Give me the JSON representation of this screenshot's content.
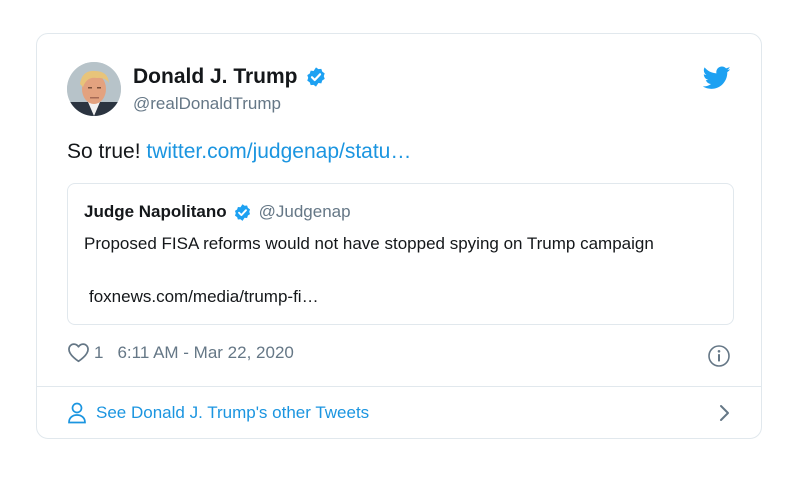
{
  "tweet": {
    "author": {
      "display_name": "Donald J. Trump",
      "handle": "@realDonaldTrump",
      "verified": true
    },
    "text_prefix": "So true! ",
    "text_link": "twitter.com/judgenap/statu…",
    "quoted": {
      "display_name": "Judge Napolitano",
      "handle": "@Judgenap",
      "verified": true,
      "text": "Proposed FISA reforms would not have stopped spying on Trump campaign",
      "link": "foxnews.com/media/trump-fi…"
    },
    "like_count": "1",
    "timestamp": "6:11 AM - Mar 22, 2020"
  },
  "footer": {
    "label": "See Donald J. Trump's other Tweets"
  },
  "icons": {
    "brand": "twitter-bird",
    "verified": "verified-badge",
    "like": "heart-outline",
    "info": "info-circle",
    "profile": "person-outline",
    "next": "chevron-right"
  },
  "colors": {
    "link": "#1b95e0",
    "verified": "#1da1f2",
    "secondary_text": "#657786",
    "border": "#e1e8ed"
  }
}
